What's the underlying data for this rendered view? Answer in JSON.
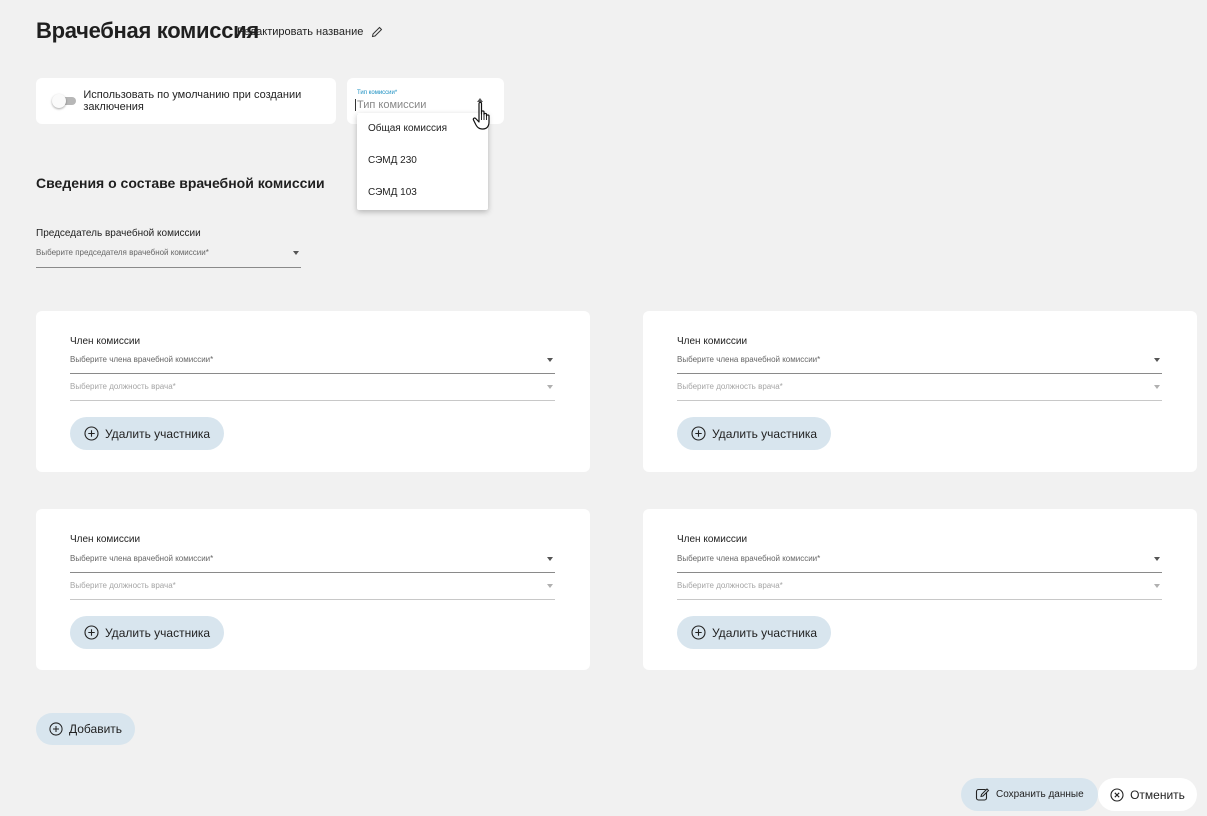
{
  "header": {
    "title": "Врачебная комиссия",
    "edit_label": "Редактировать название"
  },
  "toggle": {
    "label": "Использовать по умолчанию при создании заключения",
    "checked": false
  },
  "commission_type": {
    "label": "Тип комиссии*",
    "placeholder": "Тип комиссии",
    "options": [
      "Общая комиссия",
      "СЭМД 230",
      "СЭМД 103"
    ]
  },
  "section": {
    "title": "Сведения о составе врачебной комиссии"
  },
  "chair": {
    "label": "Председатель врачебной комиссии",
    "placeholder": "Выберите председателя врачебной комиссии*"
  },
  "members": [
    {
      "label": "Член комиссии",
      "member_placeholder": "Выберите члена врачебной комиссии*",
      "position_placeholder": "Выберите должность врача*",
      "remove_label": "Удалить участника"
    },
    {
      "label": "Член комиссии",
      "member_placeholder": "Выберите члена врачебной комиссии*",
      "position_placeholder": "Выберите должность врача*",
      "remove_label": "Удалить участника"
    },
    {
      "label": "Член комиссии",
      "member_placeholder": "Выберите члена врачебной комиссии*",
      "position_placeholder": "Выберите должность врача*",
      "remove_label": "Удалить участника"
    },
    {
      "label": "Член комиссии",
      "member_placeholder": "Выберите члена врачебной комиссии*",
      "position_placeholder": "Выберите должность врача*",
      "remove_label": "Удалить участника"
    }
  ],
  "actions": {
    "add_label": "Добавить",
    "save_label": "Сохранить данные",
    "cancel_label": "Отменить"
  },
  "colors": {
    "background": "#f1f1f1",
    "pill": "#d8e5ee",
    "accent": "#1a8fc1"
  }
}
